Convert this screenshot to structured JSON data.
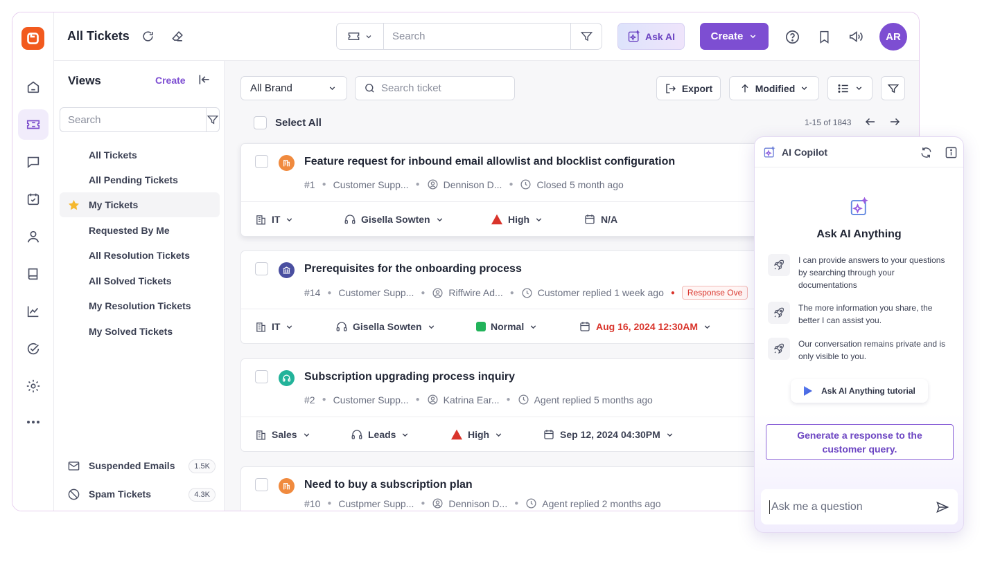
{
  "header": {
    "title": "All Tickets",
    "search_placeholder": "Search",
    "ask_ai_label": "Ask AI",
    "create_label": "Create",
    "avatar_initials": "AR"
  },
  "views": {
    "heading": "Views",
    "create_label": "Create",
    "search_placeholder": "Search",
    "items": [
      {
        "label": "All Tickets"
      },
      {
        "label": "All Pending Tickets"
      },
      {
        "label": "My Tickets"
      },
      {
        "label": "Requested By Me"
      },
      {
        "label": "All Resolution Tickets"
      },
      {
        "label": "All Solved Tickets"
      },
      {
        "label": "My Resolution Tickets"
      },
      {
        "label": "My Solved Tickets"
      }
    ],
    "footer": [
      {
        "label": "Suspended Emails",
        "count": "1.5K"
      },
      {
        "label": "Spam Tickets",
        "count": "4.3K"
      }
    ]
  },
  "toolbar": {
    "brand_value": "All Brand",
    "ticket_search_placeholder": "Search ticket",
    "export_label": "Export",
    "sort_label": "Modified",
    "select_all_label": "Select All",
    "pagination": "1-15 of 1843"
  },
  "tickets": [
    {
      "title": "Feature request for inbound email allowlist and blocklist configuration",
      "id": "#1",
      "group": "Customer Supp...",
      "agent": "Dennison D...",
      "status": "Closed 5 month ago",
      "department": "IT",
      "assignee": "Gisella Sowten",
      "priority": "High",
      "due": "N/A",
      "icon": "building-icon",
      "icon_color": "#f08a3e"
    },
    {
      "title": "Prerequisites for the onboarding process",
      "id": "#14",
      "group": "Customer Supp...",
      "agent": "Riffwire Ad...",
      "status": "Customer replied 1 week ago",
      "badge": "Response Ove",
      "department": "IT",
      "assignee": "Gisella Sowten",
      "priority": "Normal",
      "due": "Aug 16, 2024 12:30AM",
      "icon": "bank-icon",
      "icon_color": "#4a4fa0"
    },
    {
      "title": "Subscription upgrading process inquiry",
      "id": "#2",
      "group": "Customer Supp...",
      "agent": "Katrina Ear...",
      "status": "Agent replied 5 months ago",
      "department": "Sales",
      "assignee": "Leads",
      "priority": "High",
      "due": "Sep 12, 2024 04:30PM",
      "icon": "headset-icon",
      "icon_color": "#22b39a"
    },
    {
      "title": "Need to buy a subscription plan",
      "id": "#10",
      "group": "Custpmer Supp...",
      "agent": "Dennison D...",
      "status": "Agent replied 2 months ago",
      "icon": "building-icon",
      "icon_color": "#f08a3e"
    }
  ],
  "copilot": {
    "title": "AI Copilot",
    "heading": "Ask AI Anything",
    "tips": [
      "I can provide answers to your questions by searching through your documentations",
      "The more information you share, the better I can assist you.",
      "Our conversation remains private and is only visible to you."
    ],
    "tutorial_label": "Ask AI Anything tutorial",
    "suggestion": "Generate a response to the customer query.",
    "input_placeholder": "Ask me a question"
  },
  "colors": {
    "accent": "#7d4ed2",
    "brand": "#f25a1e",
    "priority_high": "#d9342b",
    "priority_normal": "#22b35a"
  }
}
